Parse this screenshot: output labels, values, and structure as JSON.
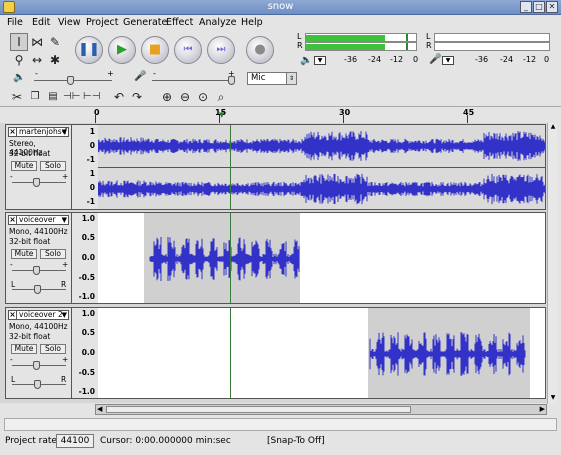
{
  "window": {
    "title": "snow"
  },
  "menu": [
    "File",
    "Edit",
    "View",
    "Project",
    "Generate",
    "Effect",
    "Analyze",
    "Help"
  ],
  "meters": {
    "output_channels": [
      "L",
      "R"
    ],
    "input_channels": [
      "L",
      "R"
    ],
    "scale": [
      "-36",
      "-24",
      "-12",
      "0"
    ],
    "output_level_L": 0.72,
    "output_level_R": 0.72
  },
  "mixer": {
    "min_label": "-",
    "max_label": "+",
    "input_source": "Mic"
  },
  "ruler": {
    "labels": [
      "0",
      "15",
      "30",
      "45"
    ]
  },
  "tracks": [
    {
      "name": "martenjohs-f",
      "info": [
        "Stereo, 44100Hz",
        "32-bit float"
      ],
      "mute": "Mute",
      "solo": "Solo",
      "gain_min": "-",
      "gain_max": "+",
      "scale_top": [
        "1",
        "0",
        "-1"
      ],
      "scale_bottom": [
        "1",
        "0",
        "-1"
      ]
    },
    {
      "name": "voiceover",
      "info": [
        "Mono, 44100Hz",
        "32-bit float"
      ],
      "mute": "Mute",
      "solo": "Solo",
      "gain_min": "-",
      "gain_max": "+",
      "pan_left": "L",
      "pan_right": "R",
      "scale": [
        "1.0",
        "0.5",
        "0.0",
        "-0.5",
        "-1.0"
      ]
    },
    {
      "name": "voiceover 2",
      "info": [
        "Mono, 44100Hz",
        "32-bit float"
      ],
      "mute": "Mute",
      "solo": "Solo",
      "gain_min": "-",
      "gain_max": "+",
      "pan_left": "L",
      "pan_right": "R",
      "scale": [
        "1.0",
        "0.5",
        "0.0",
        "-0.5",
        "-1.0"
      ]
    }
  ],
  "status": {
    "project_rate_label": "Project rate:",
    "project_rate": "44100",
    "cursor": "Cursor: 0:00.000000 min:sec",
    "snap": "[Snap-To Off]"
  },
  "colors": {
    "waveform": "#3232c8",
    "meter_green": "#3fc13f",
    "cursor": "#3a7a3a"
  }
}
